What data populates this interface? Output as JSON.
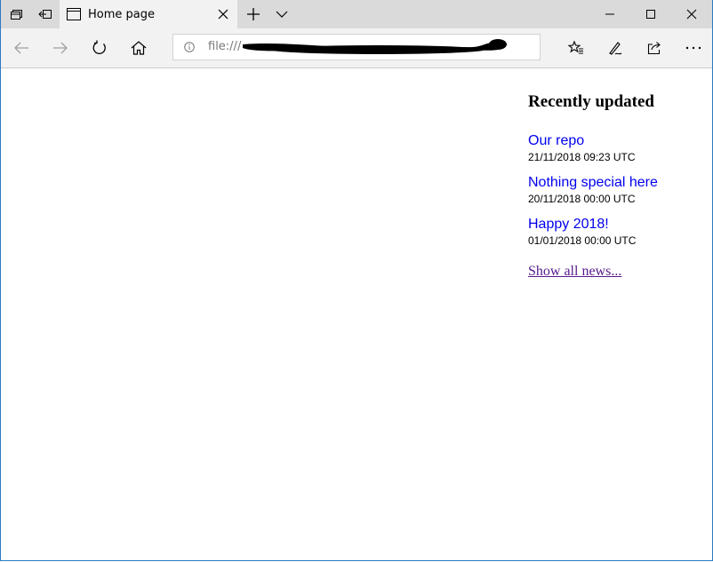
{
  "browser": {
    "tab": {
      "title": "Home page"
    },
    "address": {
      "url_prefix": "file:///"
    }
  },
  "sidebar_news": {
    "heading": "Recently updated",
    "items": [
      {
        "title": "Our repo",
        "date": "21/11/2018 09:23 UTC"
      },
      {
        "title": "Nothing special here",
        "date": "20/11/2018 00:00 UTC"
      },
      {
        "title": "Happy 2018!",
        "date": "01/01/2018 00:00 UTC"
      }
    ],
    "show_all": "Show all news..."
  },
  "colors": {
    "link": "#0000ee",
    "visited_link": "#551a8b",
    "window_border": "#2b7bbf",
    "tab_strip": "#dadada",
    "active_tab": "#f2f2f2"
  }
}
